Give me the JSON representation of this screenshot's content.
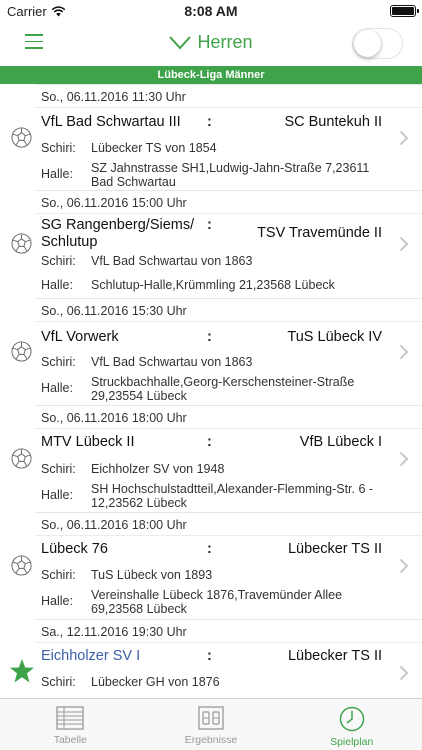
{
  "status_bar": {
    "carrier": "Carrier",
    "time": "8:08 AM"
  },
  "nav": {
    "title": "Herren",
    "toggle_on": false
  },
  "league": "Lübeck-Liga Männer",
  "labels": {
    "referee": "Schiri:",
    "hall": "Halle:"
  },
  "matches": [
    {
      "date": "So., 06.11.2016 11:30 Uhr",
      "home": "VfL Bad Schwartau III",
      "away": "SC Buntekuh II",
      "referee": "Lübecker TS von 1854",
      "hall": "SZ Jahnstrasse SH1,Ludwig-Jahn-Straße 7,23611 Bad Schwartau",
      "favorite": false
    },
    {
      "date": "So., 06.11.2016 15:00 Uhr",
      "home": "SG Rangenberg/Siems/ Schlutup",
      "away": "TSV Travemünde II",
      "referee": "VfL Bad Schwartau von 1863",
      "hall": "Schlutup-Halle,Krümmling 21,23568 Lübeck",
      "favorite": false
    },
    {
      "date": "So., 06.11.2016 15:30 Uhr",
      "home": "VfL Vorwerk",
      "away": "TuS Lübeck IV",
      "referee": "VfL Bad Schwartau von 1863",
      "hall": "Struckbachhalle,Georg-Kerschensteiner-Straße 29,23554 Lübeck",
      "favorite": false
    },
    {
      "date": "So., 06.11.2016 18:00 Uhr",
      "home": "MTV Lübeck II",
      "away": "VfB Lübeck I",
      "referee": "Eichholzer SV von 1948",
      "hall": "SH Hochschulstadtteil,Alexander-Flemming-Str. 6 - 12,23562 Lübeck",
      "favorite": false
    },
    {
      "date": "So., 06.11.2016 18:00 Uhr",
      "home": "Lübeck 76",
      "away": "Lübecker TS II",
      "referee": "TuS Lübeck von 1893",
      "hall": "Vereinshalle Lübeck 1876,Travemünder Allee 69,23568 Lübeck",
      "favorite": false
    },
    {
      "date": "Sa., 12.11.2016 19:30 Uhr",
      "home": "Eichholzer SV I",
      "away": "Lübecker TS II",
      "referee": "Lübecker GH von 1876",
      "hall": "",
      "favorite": true
    }
  ],
  "tabs": [
    {
      "label": "Tabelle",
      "icon": "table-icon",
      "active": false
    },
    {
      "label": "Ergebnisse",
      "icon": "scoreboard-icon",
      "active": false
    },
    {
      "label": "Spielplan",
      "icon": "clock-icon",
      "active": true
    }
  ],
  "colors": {
    "accent": "#3fa34a",
    "favorite_team": "#3b5fa8"
  }
}
